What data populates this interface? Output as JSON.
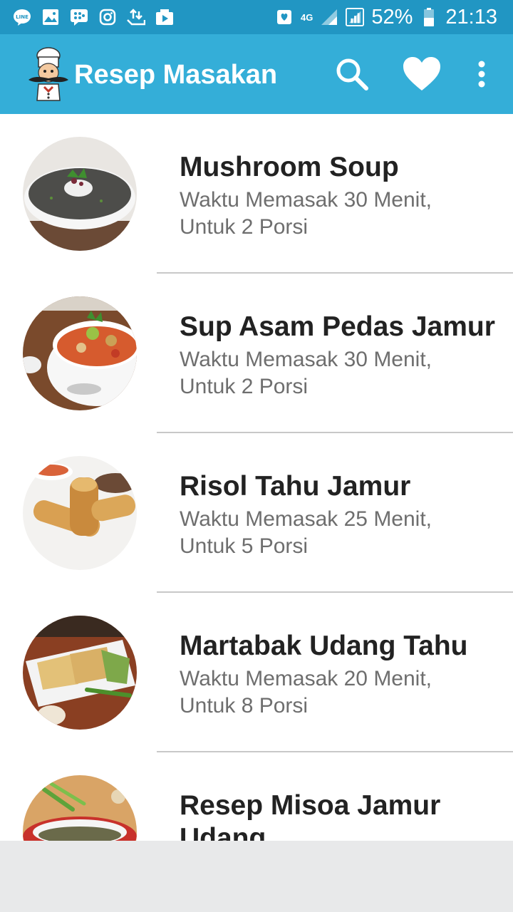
{
  "status_bar": {
    "battery": "52%",
    "time": "21:13",
    "network": "4G",
    "left_icons": [
      "line-icon",
      "gallery-icon",
      "bbm-icon",
      "instagram-icon",
      "transfer-icon",
      "video-icon"
    ],
    "right_icons": [
      "shield-icon",
      "signal-icon",
      "signal-box-icon",
      "battery-icon"
    ]
  },
  "app_bar": {
    "title": "Resep Masakan",
    "actions": [
      "search-icon",
      "heart-icon",
      "more-vert-icon"
    ]
  },
  "recipes": [
    {
      "title": "Mushroom Soup",
      "line1": "Waktu Memasak 30 Menit,",
      "line2": "Untuk 2 Porsi"
    },
    {
      "title": "Sup Asam Pedas Jamur",
      "line1": "Waktu Memasak 30 Menit,",
      "line2": "Untuk 2 Porsi"
    },
    {
      "title": "Risol Tahu Jamur",
      "line1": "Waktu Memasak 25 Menit,",
      "line2": "Untuk 5 Porsi"
    },
    {
      "title": "Martabak Udang Tahu",
      "line1": "Waktu Memasak 20 Menit,",
      "line2": "Untuk 8 Porsi"
    },
    {
      "title": "Resep Misoa Jamur Udang",
      "line1": "",
      "line2": ""
    }
  ],
  "colors": {
    "status_bar": "#2196c3",
    "app_bar": "#34aed8",
    "title_text": "#222222",
    "subtitle_text": "#6e6e6e",
    "divider": "#c8c8c8",
    "bottom_area": "#e8e9ea"
  }
}
